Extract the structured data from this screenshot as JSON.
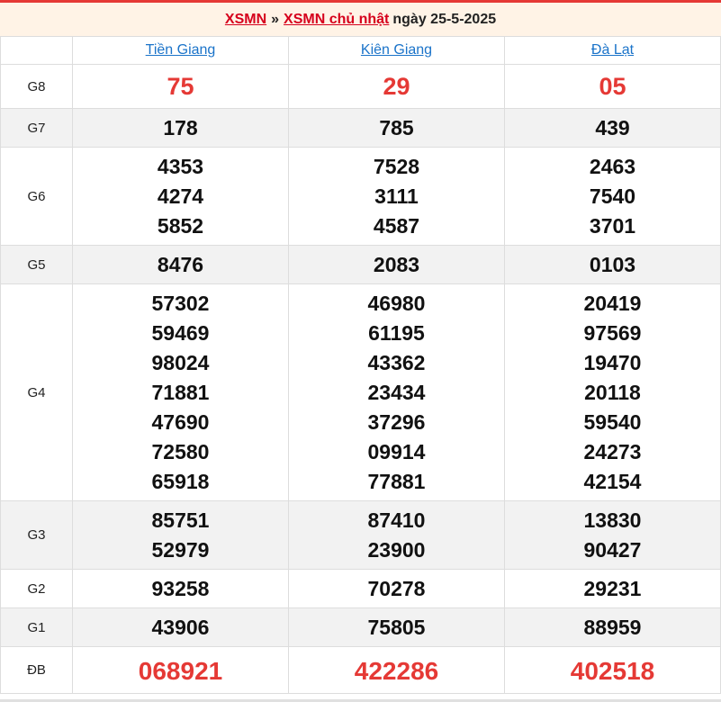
{
  "header": {
    "link_xsmn": "XSMN",
    "separator": "»",
    "link_day": "XSMN chủ nhật",
    "date_text": "ngày 25-5-2025"
  },
  "provinces": [
    "Tiền Giang",
    "Kiên Giang",
    "Đà Lạt"
  ],
  "prizes": [
    {
      "label": "G8",
      "values": [
        [
          "75"
        ],
        [
          "29"
        ],
        [
          "05"
        ]
      ]
    },
    {
      "label": "G7",
      "values": [
        [
          "178"
        ],
        [
          "785"
        ],
        [
          "439"
        ]
      ]
    },
    {
      "label": "G6",
      "values": [
        [
          "4353",
          "4274",
          "5852"
        ],
        [
          "7528",
          "3111",
          "4587"
        ],
        [
          "2463",
          "7540",
          "3701"
        ]
      ]
    },
    {
      "label": "G5",
      "values": [
        [
          "8476"
        ],
        [
          "2083"
        ],
        [
          "0103"
        ]
      ]
    },
    {
      "label": "G4",
      "values": [
        [
          "57302",
          "59469",
          "98024",
          "71881",
          "47690",
          "72580",
          "65918"
        ],
        [
          "46980",
          "61195",
          "43362",
          "23434",
          "37296",
          "09914",
          "77881"
        ],
        [
          "20419",
          "97569",
          "19470",
          "20118",
          "59540",
          "24273",
          "42154"
        ]
      ]
    },
    {
      "label": "G3",
      "values": [
        [
          "85751",
          "52979"
        ],
        [
          "87410",
          "23900"
        ],
        [
          "13830",
          "90427"
        ]
      ]
    },
    {
      "label": "G2",
      "values": [
        [
          "93258"
        ],
        [
          "70278"
        ],
        [
          "29231"
        ]
      ]
    },
    {
      "label": "G1",
      "values": [
        [
          "43906"
        ],
        [
          "75805"
        ],
        [
          "88959"
        ]
      ]
    },
    {
      "label": "ĐB",
      "values": [
        [
          "068921"
        ],
        [
          "422286"
        ],
        [
          "402518"
        ]
      ]
    }
  ],
  "colors": {
    "accent_red": "#e53935",
    "link_red": "#d6001c",
    "link_blue": "#1a73c9",
    "header_bg": "#fff3e6",
    "alt_row_bg": "#f2f2f2"
  }
}
